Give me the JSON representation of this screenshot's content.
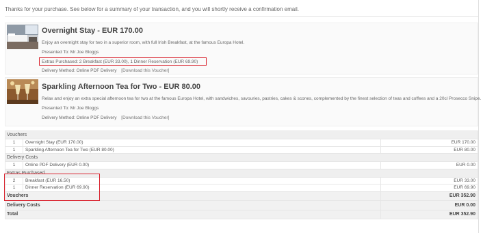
{
  "intro": "Thanks for your purchase. See below for a summary of your transaction, and you will shortly receive a confirmation email.",
  "vouchers": [
    {
      "title": "Overnight Stay - EUR 170.00",
      "description": "Enjoy an overnight stay for two in a superior room, with full Irish Breakfast, at the famous Europa Hotel.",
      "presented_to": "Presented To: Mr Joe Bloggs",
      "extras": "Extras Purchased: 2 Breakfast (EUR 33.00), 1 Dinner Reservation (EUR 69.90)",
      "delivery": "Delivery Method: Online PDF Delivery",
      "download": "[Download this Voucher]"
    },
    {
      "title": "Sparkling Afternoon Tea for Two - EUR 80.00",
      "description": "Relax and enjoy an extra special afternoon tea for two at the famous Europa Hotel, with sandwiches, savouries, pastries, cakes & scones, complemented by the finest selection of teas and coffees and a 20cl Prosecco Snipe.",
      "presented_to": "Presented To: Mr Joe Bloggs",
      "delivery": "Delivery Method: Online PDF Delivery",
      "download": "[Download this Voucher]"
    }
  ],
  "summary": {
    "sections": {
      "vouchers": "Vouchers",
      "delivery": "Delivery Costs",
      "extras": "Extras Purchased"
    },
    "voucher_rows": [
      {
        "qty": "1",
        "desc": "Overnight Stay (EUR 170.00)",
        "amount": "EUR 170.00"
      },
      {
        "qty": "1",
        "desc": "Sparkling Afternoon Tea for Two (EUR 80.00)",
        "amount": "EUR 80.00"
      }
    ],
    "delivery_rows": [
      {
        "qty": "1",
        "desc": "Online PDF Delivery (EUR 0.00)",
        "amount": "EUR 0.00"
      }
    ],
    "extras_rows": [
      {
        "qty": "2",
        "desc": "Breakfast (EUR 16.50)",
        "amount": "EUR 33.00"
      },
      {
        "qty": "1",
        "desc": "Dinner Reservation (EUR 69.90)",
        "amount": "EUR 69.90"
      }
    ],
    "totals": [
      {
        "label": "Vouchers",
        "amount": "EUR 352.90"
      },
      {
        "label": "Delivery Costs",
        "amount": "EUR 0.00"
      },
      {
        "label": "Total",
        "amount": "EUR 352.90"
      }
    ]
  },
  "colors": {
    "highlight": "#d9232e"
  },
  "icons": {
    "voucher_1": "hotel-room-image",
    "voucher_2": "prosecco-glasses-image"
  }
}
